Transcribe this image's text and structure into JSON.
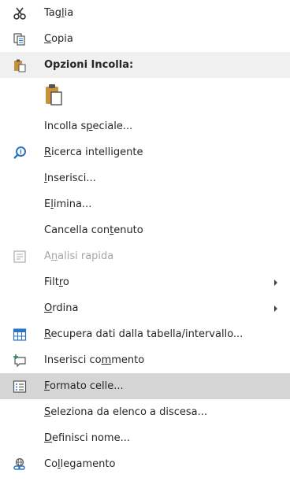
{
  "menu": {
    "items": [
      {
        "id": "taglia",
        "pre": "Tag",
        "acc": "l",
        "post": "ia"
      },
      {
        "id": "copia",
        "pre": "",
        "acc": "C",
        "post": "opia"
      },
      {
        "id": "opzioni-incolla",
        "pre": "Opzioni Incolla:",
        "acc": "",
        "post": ""
      },
      {
        "id": "incolla-speciale",
        "pre": "Incolla s",
        "acc": "p",
        "post": "eciale..."
      },
      {
        "id": "ricerca-intelligente",
        "pre": "",
        "acc": "R",
        "post": "icerca intelligente"
      },
      {
        "id": "inserisci",
        "pre": "",
        "acc": "I",
        "post": "nserisci..."
      },
      {
        "id": "elimina",
        "pre": "E",
        "acc": "l",
        "post": "imina..."
      },
      {
        "id": "cancella-contenuto",
        "pre": "Cancella con",
        "acc": "t",
        "post": "enuto"
      },
      {
        "id": "analisi-rapida",
        "pre": "A",
        "acc": "n",
        "post": "alisi rapida"
      },
      {
        "id": "filtro",
        "pre": "Filt",
        "acc": "r",
        "post": "o"
      },
      {
        "id": "ordina",
        "pre": "",
        "acc": "O",
        "post": "rdina"
      },
      {
        "id": "recupera-dati",
        "pre": "",
        "acc": "R",
        "post": "ecupera dati dalla tabella/intervallo..."
      },
      {
        "id": "inserisci-commento",
        "pre": "Inserisci co",
        "acc": "m",
        "post": "mento"
      },
      {
        "id": "formato-celle",
        "pre": "",
        "acc": "F",
        "post": "ormato celle..."
      },
      {
        "id": "seleziona-elenco",
        "pre": "",
        "acc": "S",
        "post": "eleziona da elenco a discesa..."
      },
      {
        "id": "definisci-nome",
        "pre": "",
        "acc": "D",
        "post": "efinisci nome..."
      },
      {
        "id": "collegamento",
        "pre": "Co",
        "acc": "l",
        "post": "legamento"
      }
    ]
  },
  "colors": {
    "highlight": "#d5d5d5",
    "header_bg": "#f0f0f0",
    "icon_blue": "#2b73c6",
    "icon_green": "#2e8b57",
    "clipboard_gold": "#c8923a"
  },
  "icons": {
    "taglia": "scissors-icon",
    "copia": "copy-icon",
    "opzioni-incolla": "clipboard-icon",
    "ricerca-intelligente": "smart-lookup-icon",
    "analisi-rapida": "quick-analysis-icon",
    "recupera-dati": "table-icon",
    "inserisci-commento": "new-comment-icon",
    "formato-celle": "format-cells-icon",
    "collegamento": "link-icon"
  }
}
